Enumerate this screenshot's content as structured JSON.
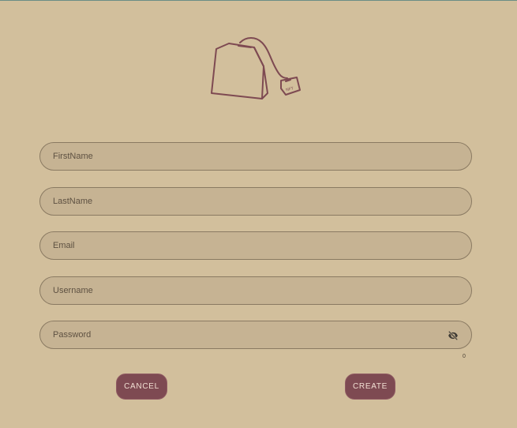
{
  "logo": {
    "icon": "tea-bag-icon",
    "tag_text": "NFT",
    "color": "#7e4a52"
  },
  "form": {
    "fields": [
      {
        "name": "firstname",
        "placeholder": "FirstName",
        "value": ""
      },
      {
        "name": "lastname",
        "placeholder": "LastName",
        "value": ""
      },
      {
        "name": "email",
        "placeholder": "Email",
        "value": ""
      },
      {
        "name": "username",
        "placeholder": "Username",
        "value": ""
      },
      {
        "name": "password",
        "placeholder": "Password",
        "value": "",
        "toggle_icon": "eye-off-icon"
      }
    ],
    "password_counter": "0"
  },
  "actions": {
    "cancel_label": "CANCEL",
    "create_label": "CREATE"
  },
  "colors": {
    "background": "#d2bf9c",
    "field_fill": "#c6b393",
    "accent": "#7e4a52"
  }
}
